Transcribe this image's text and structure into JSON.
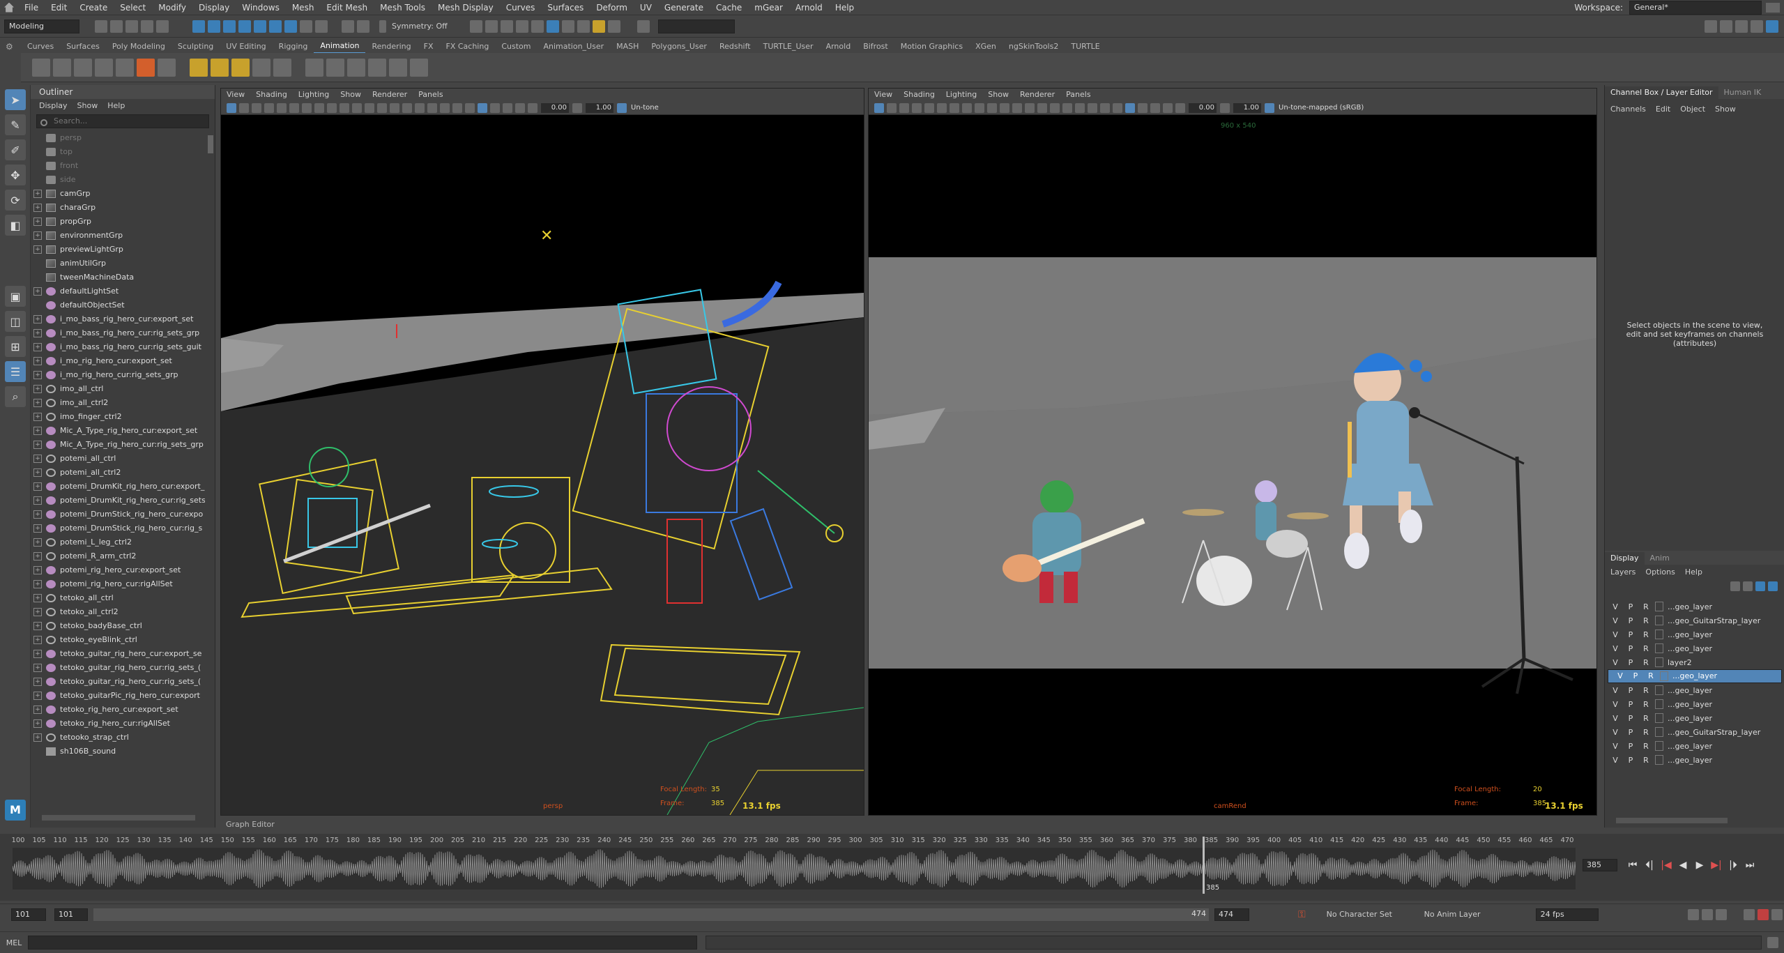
{
  "menubar": {
    "items": [
      "File",
      "Edit",
      "Create",
      "Select",
      "Modify",
      "Display",
      "Windows",
      "Mesh",
      "Edit Mesh",
      "Mesh Tools",
      "Mesh Display",
      "Curves",
      "Surfaces",
      "Deform",
      "UV",
      "Generate",
      "Cache",
      "mGear",
      "Arnold",
      "Help"
    ],
    "workspace_label": "Workspace:",
    "workspace_value": "General*"
  },
  "statusline": {
    "menuset": "Modeling",
    "symmetry": "Symmetry: Off"
  },
  "shelf": {
    "tabs": [
      "Curves",
      "Surfaces",
      "Poly Modeling",
      "Sculpting",
      "UV Editing",
      "Rigging",
      "Animation",
      "Rendering",
      "FX",
      "FX Caching",
      "Custom",
      "Animation_User",
      "MASH",
      "Polygons_User",
      "Redshift",
      "TURTLE_User",
      "Arnold",
      "Bifrost",
      "Motion Graphics",
      "XGen",
      "ngSkinTools2",
      "TURTLE"
    ],
    "active_tab": "Animation"
  },
  "outliner": {
    "title": "Outliner",
    "menus": [
      "Display",
      "Show",
      "Help"
    ],
    "search_placeholder": "Search...",
    "items": [
      {
        "label": "persp",
        "icon": "cam",
        "expand": false,
        "dim": true
      },
      {
        "label": "top",
        "icon": "cam",
        "expand": false,
        "dim": true
      },
      {
        "label": "front",
        "icon": "cam",
        "expand": false,
        "dim": true
      },
      {
        "label": "side",
        "icon": "cam",
        "expand": false,
        "dim": true
      },
      {
        "label": "camGrp",
        "icon": "grp",
        "expand": true
      },
      {
        "label": "charaGrp",
        "icon": "grp",
        "expand": true
      },
      {
        "label": "propGrp",
        "icon": "grp",
        "expand": true
      },
      {
        "label": "environmentGrp",
        "icon": "grp",
        "expand": true
      },
      {
        "label": "previewLightGrp",
        "icon": "grp",
        "expand": true
      },
      {
        "label": "animUtilGrp",
        "icon": "grp",
        "expand": false
      },
      {
        "label": "tweenMachineData",
        "icon": "grp",
        "expand": false
      },
      {
        "label": "defaultLightSet",
        "icon": "set",
        "expand": true
      },
      {
        "label": "defaultObjectSet",
        "icon": "set",
        "expand": false
      },
      {
        "label": "i_mo_bass_rig_hero_cur:export_set",
        "icon": "set",
        "expand": true
      },
      {
        "label": "i_mo_bass_rig_hero_cur:rig_sets_grp",
        "icon": "set",
        "expand": true
      },
      {
        "label": "i_mo_bass_rig_hero_cur:rig_sets_guit",
        "icon": "set",
        "expand": true
      },
      {
        "label": "i_mo_rig_hero_cur:export_set",
        "icon": "set",
        "expand": true
      },
      {
        "label": "i_mo_rig_hero_cur:rig_sets_grp",
        "icon": "set",
        "expand": true
      },
      {
        "label": "imo_all_ctrl",
        "icon": "curve",
        "expand": true
      },
      {
        "label": "imo_all_ctrl2",
        "icon": "curve",
        "expand": true
      },
      {
        "label": "imo_finger_ctrl2",
        "icon": "curve",
        "expand": true
      },
      {
        "label": "Mic_A_Type_rig_hero_cur:export_set",
        "icon": "set",
        "expand": true
      },
      {
        "label": "Mic_A_Type_rig_hero_cur:rig_sets_grp",
        "icon": "set",
        "expand": true
      },
      {
        "label": "potemi_all_ctrl",
        "icon": "curve",
        "expand": true
      },
      {
        "label": "potemi_all_ctrl2",
        "icon": "curve",
        "expand": true
      },
      {
        "label": "potemi_DrumKit_rig_hero_cur:export_",
        "icon": "set",
        "expand": true
      },
      {
        "label": "potemi_DrumKit_rig_hero_cur:rig_sets",
        "icon": "set",
        "expand": true
      },
      {
        "label": "potemi_DrumStick_rig_hero_cur:expo",
        "icon": "set",
        "expand": true
      },
      {
        "label": "potemi_DrumStick_rig_hero_cur:rig_s",
        "icon": "set",
        "expand": true
      },
      {
        "label": "potemi_L_leg_ctrl2",
        "icon": "curve",
        "expand": true
      },
      {
        "label": "potemi_R_arm_ctrl2",
        "icon": "curve",
        "expand": true
      },
      {
        "label": "potemi_rig_hero_cur:export_set",
        "icon": "set",
        "expand": true
      },
      {
        "label": "potemi_rig_hero_cur:rigAllSet",
        "icon": "set",
        "expand": true
      },
      {
        "label": "tetoko_all_ctrl",
        "icon": "curve",
        "expand": true
      },
      {
        "label": "tetoko_all_ctrl2",
        "icon": "curve",
        "expand": true
      },
      {
        "label": "tetoko_badyBase_ctrl",
        "icon": "curve",
        "expand": true
      },
      {
        "label": "tetoko_eyeBlink_ctrl",
        "icon": "curve",
        "expand": true
      },
      {
        "label": "tetoko_guitar_rig_hero_cur:export_se",
        "icon": "set",
        "expand": true
      },
      {
        "label": "tetoko_guitar_rig_hero_cur:rig_sets_(",
        "icon": "set",
        "expand": true
      },
      {
        "label": "tetoko_guitar_rig_hero_cur:rig_sets_(",
        "icon": "set",
        "expand": true
      },
      {
        "label": "tetoko_guitarPic_rig_hero_cur:export",
        "icon": "set",
        "expand": true
      },
      {
        "label": "tetoko_rig_hero_cur:export_set",
        "icon": "set",
        "expand": true
      },
      {
        "label": "tetoko_rig_hero_cur:rigAllSet",
        "icon": "set",
        "expand": true
      },
      {
        "label": "tetooko_strap_ctrl",
        "icon": "curve",
        "expand": true
      },
      {
        "label": "sh106B_sound",
        "icon": "snd",
        "expand": false
      }
    ]
  },
  "viewport_left": {
    "menus": [
      "View",
      "Shading",
      "Lighting",
      "Show",
      "Renderer",
      "Panels"
    ],
    "field_a": "0.00",
    "field_b": "1.00",
    "colorspace": "Un-tone",
    "hud_focal_label": "Focal Length:",
    "hud_focal_value": "35",
    "hud_frame_label": "Frame:",
    "hud_frame_value": "385",
    "fps": "13.1 fps",
    "cam_name": "persp"
  },
  "viewport_right": {
    "menus": [
      "View",
      "Shading",
      "Lighting",
      "Show",
      "Renderer",
      "Panels"
    ],
    "field_a": "0.00",
    "field_b": "1.00",
    "colorspace": "Un-tone-mapped (sRGB)",
    "resolution": "960 x 540",
    "hud_focal_label": "Focal Length:",
    "hud_focal_value": "20",
    "hud_frame_label": "Frame:",
    "hud_frame_value": "385",
    "fps": "13.1 fps",
    "cam_name": "camRend"
  },
  "graph_editor_label": "Graph Editor",
  "channelbox": {
    "tabs": [
      "Channel Box / Layer Editor",
      "Human IK"
    ],
    "menus": [
      "Channels",
      "Edit",
      "Object",
      "Show"
    ],
    "hint": "Select objects in the scene to view, edit and set keyframes on channels (attributes)",
    "layer_tabs": [
      "Display",
      "Anim"
    ],
    "layer_menus": [
      "Layers",
      "Options",
      "Help"
    ],
    "layers": [
      {
        "name": "...geo_layer",
        "selected": false
      },
      {
        "name": "...geo_GuitarStrap_layer",
        "selected": false
      },
      {
        "name": "...geo_layer",
        "selected": false
      },
      {
        "name": "...geo_layer",
        "selected": false
      },
      {
        "name": "layer2",
        "selected": false
      },
      {
        "name": "...geo_layer",
        "selected": true
      },
      {
        "name": "...geo_layer",
        "selected": false
      },
      {
        "name": "...geo_layer",
        "selected": false
      },
      {
        "name": "...geo_layer",
        "selected": false
      },
      {
        "name": "...geo_GuitarStrap_layer",
        "selected": false
      },
      {
        "name": "...geo_layer",
        "selected": false
      },
      {
        "name": "...geo_layer",
        "selected": false
      }
    ],
    "vpr": [
      "V",
      "P",
      "R"
    ]
  },
  "timeline": {
    "ticks": [
      "100",
      "105",
      "110",
      "115",
      "120",
      "125",
      "130",
      "135",
      "140",
      "145",
      "150",
      "155",
      "160",
      "165",
      "170",
      "175",
      "180",
      "185",
      "190",
      "195",
      "200",
      "205",
      "210",
      "215",
      "220",
      "225",
      "230",
      "235",
      "240",
      "245",
      "250",
      "255",
      "260",
      "265",
      "270",
      "275",
      "280",
      "285",
      "290",
      "295",
      "300",
      "305",
      "310",
      "315",
      "320",
      "325",
      "330",
      "335",
      "340",
      "345",
      "350",
      "355",
      "360",
      "365",
      "370",
      "375",
      "380",
      "385",
      "390",
      "395",
      "400",
      "405",
      "410",
      "415",
      "420",
      "425",
      "430",
      "435",
      "440",
      "445",
      "450",
      "455",
      "460",
      "465",
      "470"
    ],
    "current_frame": "385",
    "current_field": "385"
  },
  "range": {
    "start": "101",
    "start_inner": "101",
    "end_inner": "474",
    "end": "474",
    "character_set": "No Character Set",
    "anim_layer": "No Anim Layer",
    "fps": "24 fps"
  },
  "cmdline": {
    "label": "MEL"
  },
  "colors": {
    "accent": "#5285b7",
    "hud_label": "#d0501e",
    "hud_value": "#e8d030"
  }
}
